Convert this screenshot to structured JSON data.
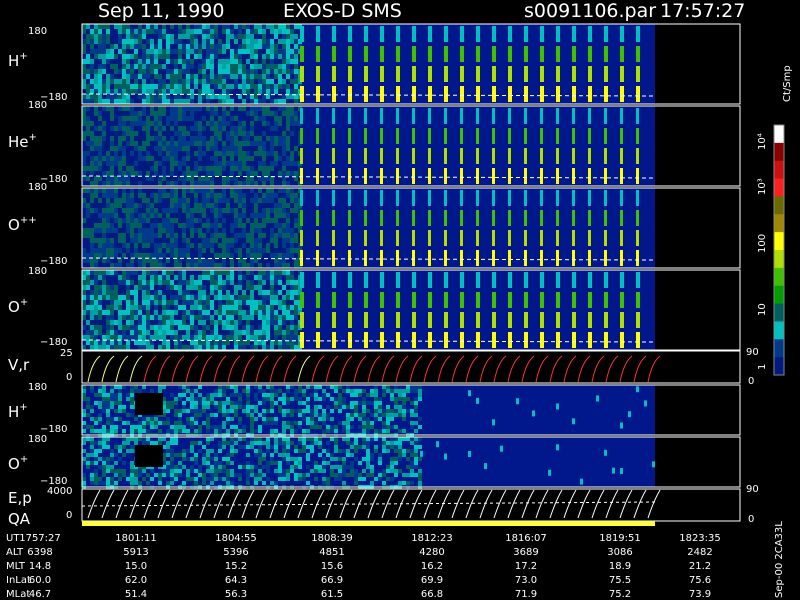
{
  "header": {
    "date": "Sep 11, 1990",
    "instrument": "EXOS-D SMS",
    "file": "s0091106.par",
    "time": "17:57:27"
  },
  "colorbar": {
    "label": "Ct/Smp",
    "ticks": [
      "10⁴",
      "10³",
      "100",
      "10",
      "1"
    ],
    "colors": [
      "#ffffff",
      "#8b0000",
      "#cc1010",
      "#ff2020",
      "#6b6b00",
      "#a08800",
      "#ffff00",
      "#b0e000",
      "#40c000",
      "#00a000",
      "#006060",
      "#00c0c0",
      "#003a8a",
      "#001a80"
    ]
  },
  "panels": {
    "hplus": {
      "label": "H",
      "sup": "+",
      "ytop": "180",
      "ybot": "−180"
    },
    "heplus": {
      "label": "He",
      "sup": "+",
      "ytop": "180",
      "ybot": "−180"
    },
    "oppplus": {
      "label": "O",
      "sup": "++",
      "ytop": "180",
      "ybot": "−180"
    },
    "oplus": {
      "label": "O",
      "sup": "+",
      "ytop": "180",
      "ybot": "−180"
    },
    "vr": {
      "label": "V,r",
      "ytop": "25",
      "ybot": "0",
      "rtop": "90",
      "rbot": "0"
    },
    "hplus2": {
      "label": "H",
      "sup": "+",
      "ytop": "180",
      "ybot": "−180"
    },
    "oplus2": {
      "label": "O",
      "sup": "+",
      "ytop": "180",
      "ybot": "−180"
    },
    "ep": {
      "label": "E,p",
      "label2": "QA",
      "ytop": "4000",
      "ybot": "0",
      "rtop": "90",
      "rbot": "0"
    }
  },
  "side_label": "Sep-00 2CA33L",
  "footer": {
    "row_labels": [
      "UT",
      "ALT",
      "MLT",
      "InLat",
      "MLat"
    ],
    "ut": [
      "1757:27",
      "1801:11",
      "1804:55",
      "1808:39",
      "1812:23",
      "1816:07",
      "1819:51",
      "1823:35"
    ],
    "alt": [
      "6398",
      "5913",
      "5396",
      "4851",
      "4280",
      "3689",
      "3086",
      "2482"
    ],
    "mlt": [
      "14.8",
      "15.0",
      "15.2",
      "15.6",
      "16.2",
      "17.2",
      "18.9",
      "21.2"
    ],
    "inlat": [
      "60.0",
      "62.0",
      "64.3",
      "66.9",
      "69.9",
      "73.0",
      "75.5",
      "75.6"
    ],
    "mlat": [
      "46.7",
      "51.4",
      "56.3",
      "61.5",
      "66.8",
      "71.9",
      "75.2",
      "73.9"
    ]
  },
  "chart_data": {
    "type": "heatmap",
    "title": "Sep 11, 1990   EXOS-D SMS",
    "x": [
      "1757:27",
      "1801:11",
      "1804:55",
      "1808:39",
      "1812:23",
      "1816:07",
      "1819:51",
      "1823:35"
    ],
    "series": [
      {
        "name": "H+",
        "ylim": [
          -180,
          180
        ]
      },
      {
        "name": "He+",
        "ylim": [
          -180,
          180
        ]
      },
      {
        "name": "O++",
        "ylim": [
          -180,
          180
        ]
      },
      {
        "name": "O+",
        "ylim": [
          -180,
          180
        ]
      },
      {
        "name": "V,r",
        "ylim": [
          0,
          25
        ]
      },
      {
        "name": "H+",
        "ylim": [
          -180,
          180
        ]
      },
      {
        "name": "O+",
        "ylim": [
          -180,
          180
        ]
      },
      {
        "name": "E,p",
        "ylim": [
          0,
          4000
        ]
      }
    ],
    "colorscale_label": "Ct/Smp",
    "colorscale_ticks": [
      "1",
      "10",
      "100",
      "10³",
      "10⁴"
    ]
  }
}
